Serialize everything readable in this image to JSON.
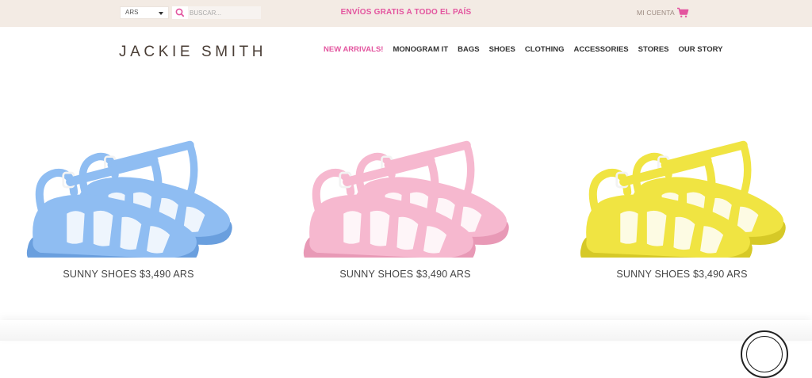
{
  "topbar": {
    "currency": "ARS",
    "search_placeholder": "BUSCAR...",
    "promo": "ENVÍOS GRATIS A TODO EL PAÍS",
    "account": "MI CUENTA",
    "colors": {
      "background": "#f3ebe4",
      "accent": "#e3559f"
    }
  },
  "header": {
    "logo": "JACKIE SMITH",
    "nav": [
      {
        "label": "NEW ARRIVALS!",
        "highlight": true
      },
      {
        "label": "MONOGRAM IT"
      },
      {
        "label": "BAGS"
      },
      {
        "label": "SHOES"
      },
      {
        "label": "CLOTHING"
      },
      {
        "label": "ACCESSORIES"
      },
      {
        "label": "STORES"
      },
      {
        "label": "OUR STORY"
      }
    ]
  },
  "products": [
    {
      "label": "SUNNY SHOES $3,490 ARS",
      "color": "#8fbdf2",
      "dark": "#6a9fde"
    },
    {
      "label": "SUNNY SHOES $3,490 ARS",
      "color": "#f6b8cf",
      "dark": "#e899b6"
    },
    {
      "label": "SUNNY SHOES $3,490 ARS",
      "color": "#f0e442",
      "dark": "#d6c927"
    }
  ]
}
